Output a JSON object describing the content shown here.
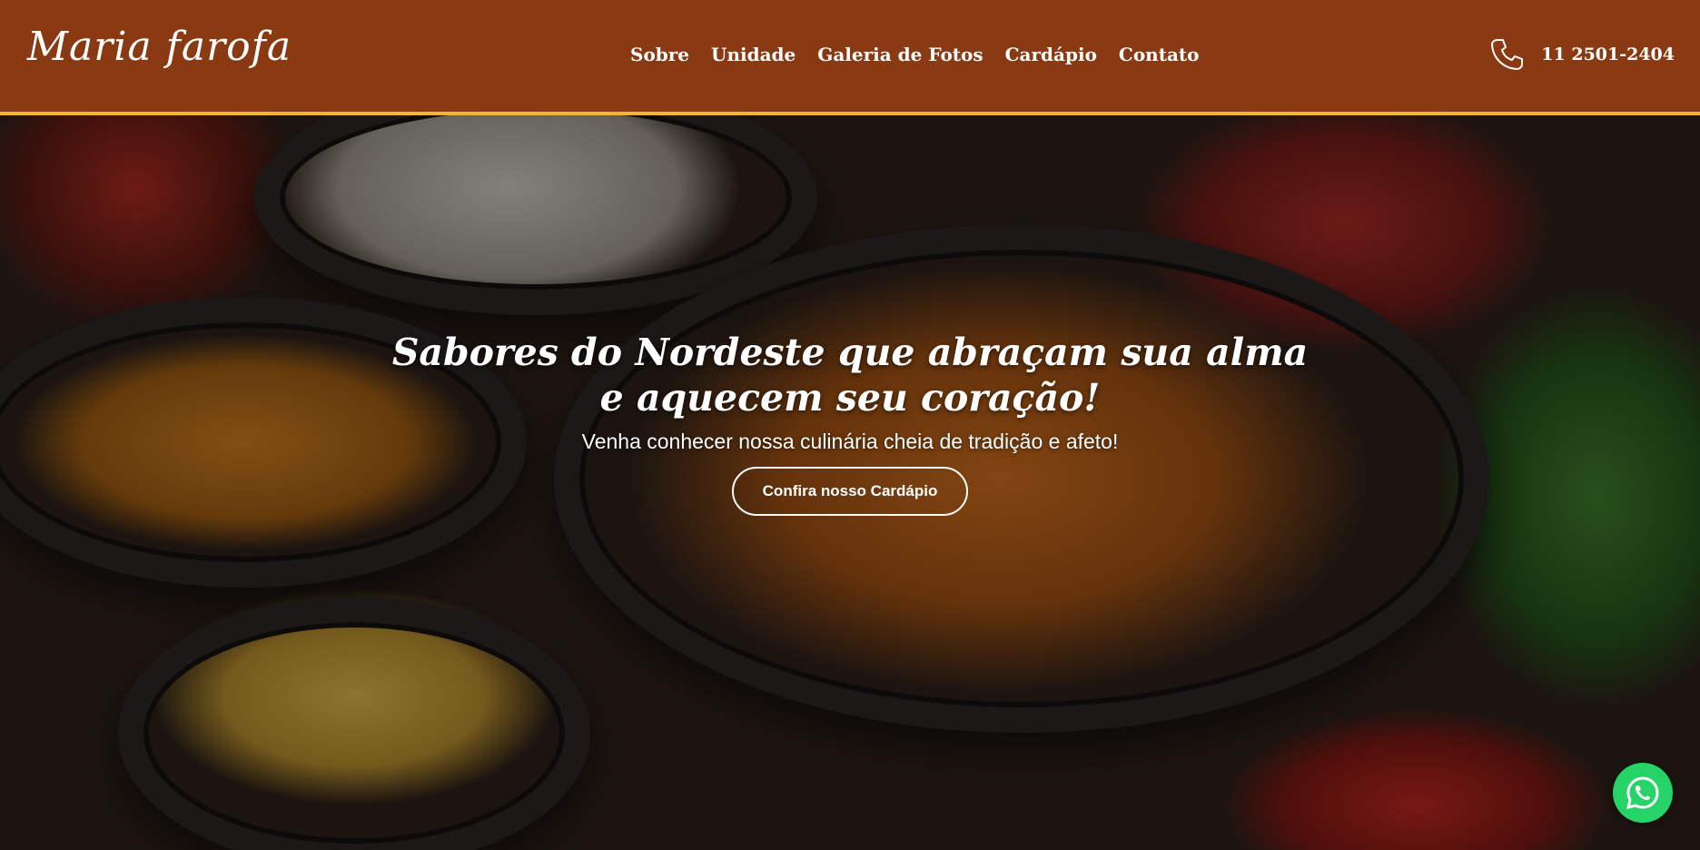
{
  "header": {
    "logo": "Maria farofa",
    "nav": [
      "Sobre",
      "Unidade",
      "Galeria de Fotos",
      "Cardápio",
      "Contato"
    ],
    "phone": "11 2501-2404",
    "phone_icon": "phone-icon"
  },
  "hero": {
    "title_line1": "Sabores do Nordeste que abraçam sua alma",
    "title_line2": "e aquecem seu coração!",
    "subtitle": "Venha conhecer nossa culinária cheia de tradição e afeto!",
    "cta_label": "Confira nosso Cardápio"
  },
  "floating": {
    "whatsapp_icon": "whatsapp-icon"
  },
  "colors": {
    "header_bg": "#8a3a12",
    "header_border": "#f2b43a",
    "whatsapp": "#25d366"
  }
}
